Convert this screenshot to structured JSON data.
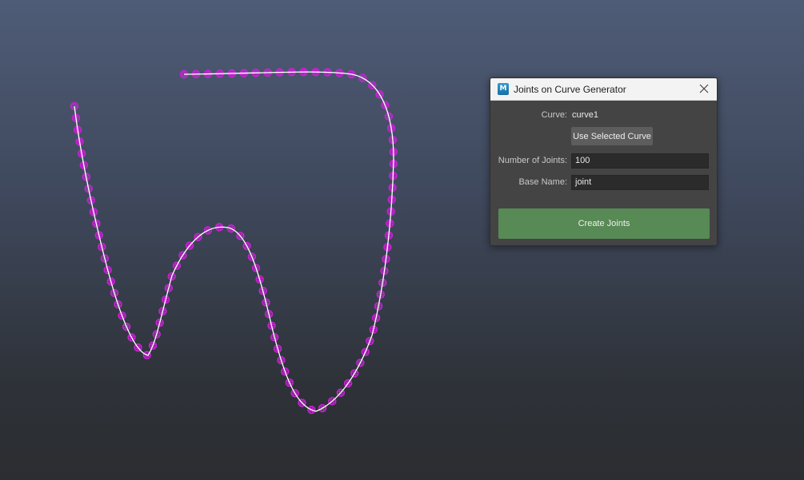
{
  "viewport": {
    "curve_color": "#ffffff",
    "joint_color": "#cc22d9"
  },
  "dialog": {
    "app_icon_label": "M",
    "title": "Joints on Curve Generator",
    "close_icon": "close-icon",
    "curve_label": "Curve:",
    "curve_value": "curve1",
    "use_selected_label": "Use Selected Curve",
    "num_joints_label": "Number of Joints:",
    "num_joints_value": "100",
    "base_name_label": "Base Name:",
    "base_name_value": "joint",
    "create_label": "Create Joints",
    "create_color": "#578a54"
  }
}
